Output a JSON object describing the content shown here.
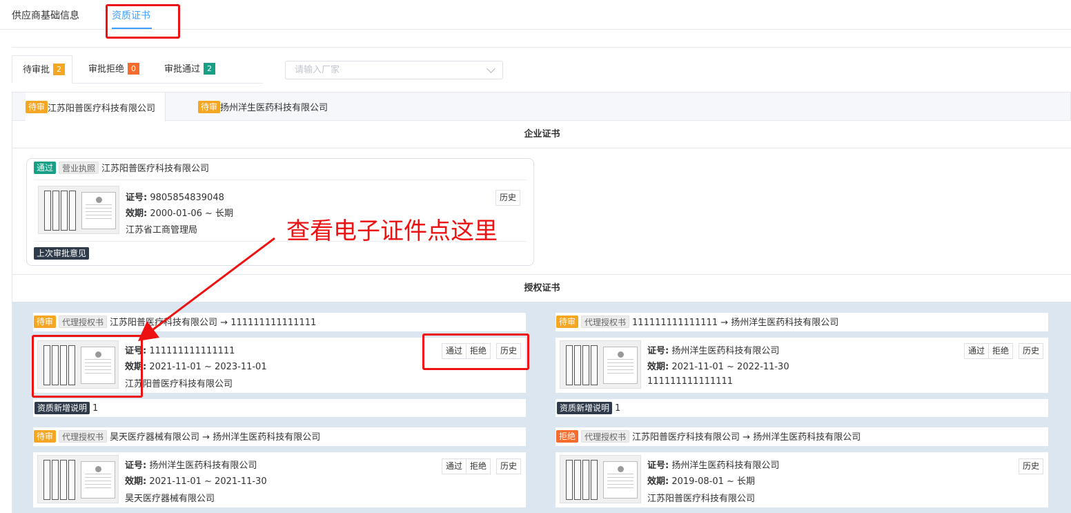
{
  "top_tabs": [
    {
      "label": "供应商基础信息"
    },
    {
      "label": "资质证书"
    }
  ],
  "status_tabs": [
    {
      "label": "待审批",
      "count": "2"
    },
    {
      "label": "审批拒绝",
      "count": "0"
    },
    {
      "label": "审批通过",
      "count": "2"
    }
  ],
  "vendor_select": {
    "placeholder": "请输入厂家"
  },
  "companies": [
    {
      "status": "待审",
      "name": "江苏阳普医疗科技有限公司"
    },
    {
      "status": "待审",
      "name": "扬州洋生医药科技有限公司"
    }
  ],
  "sections": {
    "enterprise": "企业证书",
    "authorization": "授权证书"
  },
  "labels": {
    "cert_no": "证号:",
    "validity": "效期:",
    "history": "历史",
    "approve": "通过",
    "reject": "拒绝",
    "last_opinion": "上次审批意见",
    "new_desc": "资质新增说明"
  },
  "enterprise_card": {
    "status": "通过",
    "type": "营业执照",
    "title": "江苏阳普医疗科技有限公司",
    "cert_no": "9805854839048",
    "validity": "2000-01-06 ~ 长期",
    "issuer": "江苏省工商管理局"
  },
  "auth_cards": [
    {
      "status": "待审",
      "type": "代理授权书",
      "title": "江苏阳普医疗科技有限公司 → 111111111111111",
      "cert_no": "111111111111111",
      "validity": "2021-11-01 ~ 2023-11-01",
      "issuer": "江苏阳普医疗科技有限公司",
      "desc": "1"
    },
    {
      "status": "待审",
      "type": "代理授权书",
      "title": "111111111111111 → 扬州洋生医药科技有限公司",
      "cert_no": "扬州洋生医药科技有限公司",
      "validity": "2021-11-01 ~ 2022-11-30",
      "issuer": "111111111111111",
      "desc": "1"
    },
    {
      "status": "待审",
      "type": "代理授权书",
      "title": "昊天医疗器械有限公司 → 扬州洋生医药科技有限公司",
      "cert_no": "扬州洋生医药科技有限公司",
      "validity": "2021-11-01 ~ 2021-11-30",
      "issuer": "昊天医疗器械有限公司"
    },
    {
      "status": "拒绝",
      "type": "代理授权书",
      "title": "江苏阳普医疗科技有限公司 → 扬州洋生医药科技有限公司",
      "cert_no": "扬州洋生医药科技有限公司",
      "validity": "2019-08-01 ~ 长期",
      "issuer": "江苏阳普医疗科技有限公司"
    }
  ],
  "annotation": {
    "text": "查看电子证件点这里",
    "color": "#ee1111"
  }
}
